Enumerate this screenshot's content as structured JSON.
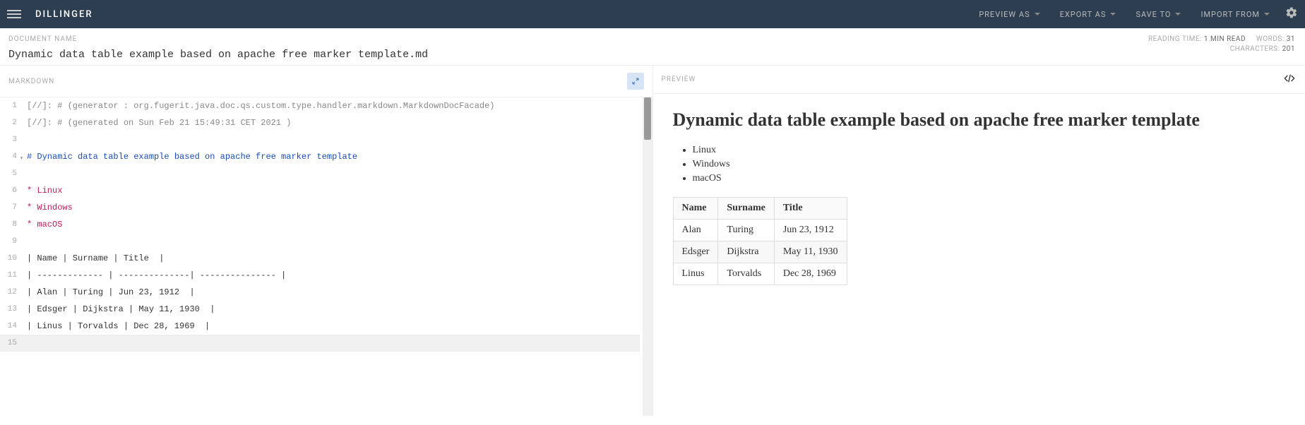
{
  "nav": {
    "brand": "DILLINGER",
    "items": [
      "PREVIEW AS",
      "EXPORT AS",
      "SAVE TO",
      "IMPORT FROM"
    ]
  },
  "doc": {
    "label": "DOCUMENT NAME",
    "title": "Dynamic data table example based on apache free marker template.md"
  },
  "stats": {
    "reading_label": "READING TIME:",
    "reading_value": "1 MIN READ",
    "words_label": "WORDS:",
    "words_value": "31",
    "chars_label": "CHARACTERS:",
    "chars_value": "201"
  },
  "panes": {
    "left_label": "MARKDOWN",
    "right_label": "PREVIEW"
  },
  "editor_lines": [
    {
      "n": "1",
      "cls": "c-comment",
      "text": "[//]: # (generator : org.fugerit.java.doc.qs.custom.type.handler.markdown.MarkdownDocFacade)"
    },
    {
      "n": "2",
      "cls": "c-comment",
      "text": "[//]: # (generated on Sun Feb 21 15:49:31 CET 2021 )"
    },
    {
      "n": "3",
      "cls": "",
      "text": ""
    },
    {
      "n": "4",
      "cls": "c-heading",
      "text": "# Dynamic data table example based on apache free marker template",
      "fold": true
    },
    {
      "n": "5",
      "cls": "",
      "text": ""
    },
    {
      "n": "6",
      "cls": "c-list",
      "text": "* Linux"
    },
    {
      "n": "7",
      "cls": "c-list",
      "text": "* Windows"
    },
    {
      "n": "8",
      "cls": "c-list",
      "text": "* macOS"
    },
    {
      "n": "9",
      "cls": "",
      "text": ""
    },
    {
      "n": "10",
      "cls": "c-table",
      "text": "| Name | Surname | Title  |"
    },
    {
      "n": "11",
      "cls": "c-table",
      "text": "| ------------- | --------------| --------------- |"
    },
    {
      "n": "12",
      "cls": "c-table",
      "text": "| Alan | Turing | Jun 23, 1912  |"
    },
    {
      "n": "13",
      "cls": "c-table",
      "text": "| Edsger | Dijkstra | May 11, 1930  |"
    },
    {
      "n": "14",
      "cls": "c-table",
      "text": "| Linus | Torvalds | Dec 28, 1969  |"
    },
    {
      "n": "15",
      "cls": "",
      "text": "",
      "active": true
    }
  ],
  "preview": {
    "heading": "Dynamic data table example based on apache free marker template",
    "bullets": [
      "Linux",
      "Windows",
      "macOS"
    ],
    "table": {
      "headers": [
        "Name",
        "Surname",
        "Title"
      ],
      "rows": [
        [
          "Alan",
          "Turing",
          "Jun 23, 1912"
        ],
        [
          "Edsger",
          "Dijkstra",
          "May 11, 1930"
        ],
        [
          "Linus",
          "Torvalds",
          "Dec 28, 1969"
        ]
      ]
    }
  }
}
